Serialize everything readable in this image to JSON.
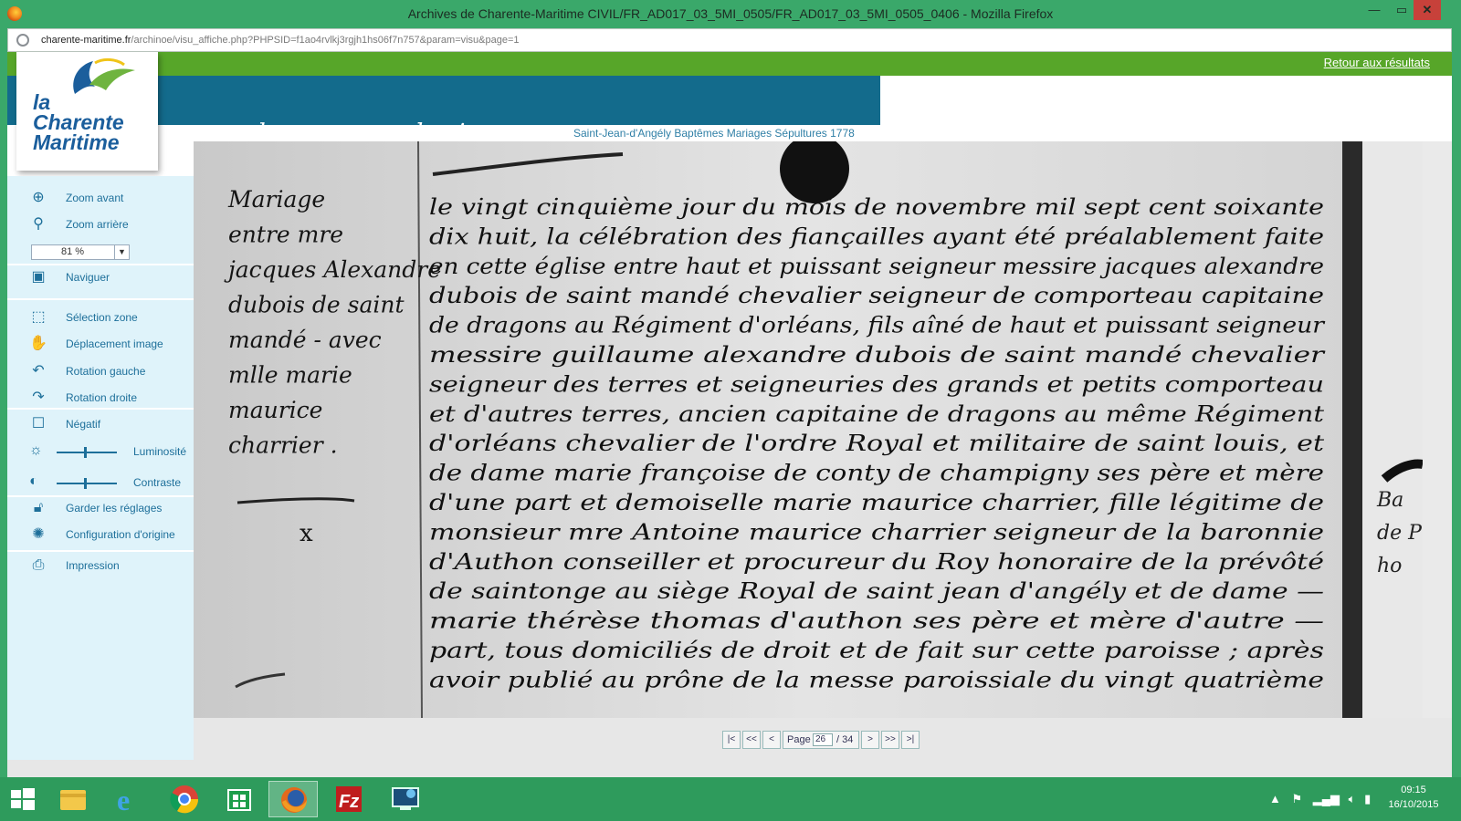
{
  "window": {
    "title": "Archives de Charente-Maritime CIVIL/FR_AD017_03_5MI_0505/FR_AD017_03_5MI_0505_0406 - Mozilla Firefox",
    "minimize": "—",
    "maximize": "▭",
    "close": "✕"
  },
  "address": {
    "domain": "charente-maritime.fr",
    "path": "/archinoe/visu_affiche.php?PHPSID=f1ao4rvlkj3rgjh1hs06f7n757&param=visu&page=1"
  },
  "header": {
    "back_link": "Retour aux résultats",
    "slogan": "ouvre de nouveaux horizons",
    "logo_lines": [
      "la",
      "Charente",
      "Maritime"
    ],
    "doc_title": "Saint-Jean-d'Angély Baptêmes Mariages Sépultures 1778"
  },
  "sidebar": {
    "zoom_in": "Zoom avant",
    "zoom_out": "Zoom arrière",
    "zoom_value": "81 %",
    "navigate": "Naviguer",
    "select_zone": "Sélection zone",
    "move_image": "Déplacement image",
    "rotate_left": "Rotation gauche",
    "rotate_right": "Rotation droite",
    "negative": "Négatif",
    "brightness": "Luminosité",
    "contrast": "Contraste",
    "keep_settings": "Garder les réglages",
    "reset_settings": "Configuration d'origine",
    "print": "Impression"
  },
  "pager": {
    "first": "|<",
    "prev_fast": "<<",
    "prev": "<",
    "page_label": "Page",
    "current_page": "26",
    "total": "/ 34",
    "next": ">",
    "next_fast": ">>",
    "last": ">|"
  },
  "manuscript": {
    "margin_lines": [
      "Mariage",
      "entre mre",
      "jacques Alexandre",
      "dubois de saint",
      "mandé - avec",
      "mlle marie",
      "maurice",
      "charrier ."
    ],
    "margin_mark": "x",
    "body_lines": [
      "le vingt cinquième jour du mois de novembre mil sept cent soixante",
      "dix huit, la célébration des fiançailles ayant été préalablement faite",
      "en cette église entre haut et puissant seigneur messire jacques alexandre",
      "dubois de saint mandé chevalier seigneur de comporteau capitaine",
      "de dragons au Régiment d'orléans, fils aîné de haut et puissant seigneur",
      "messire guillaume alexandre dubois de saint mandé chevalier",
      "seigneur des terres et seigneuries des grands et petits comporteau",
      "et d'autres terres, ancien capitaine de dragons au même Régiment",
      "d'orléans chevalier de l'ordre Royal et militaire de saint louis, et",
      "de dame marie françoise de conty de champigny ses père et mère",
      "d'une part et demoiselle marie maurice charrier, fille légitime de",
      "monsieur mre Antoine maurice charrier seigneur de la baronnie",
      "d'Authon conseiller et procureur du Roy honoraire de la prévôté",
      "de saintonge au siège Royal de saint jean d'angély et de dame —",
      "marie thérèse thomas d'authon ses père et mère d'autre —",
      "part, tous domiciliés de droit et de fait sur cette paroisse ; après",
      "avoir publié au prône de la messe paroissiale du vingt quatrième"
    ],
    "edge_text": [
      "Ba",
      "de P",
      "ho"
    ]
  },
  "taskbar": {
    "apps": [
      "start",
      "file-explorer",
      "internet-explorer",
      "chrome",
      "store",
      "firefox",
      "filezilla",
      "remote-desktop"
    ],
    "clock_time": "09:15",
    "clock_date": "16/10/2015"
  },
  "colors": {
    "titlebar": "#3aa86a",
    "green_band": "#57a629",
    "banner_blue": "#136b8c",
    "sidebar_bg": "#dff3fa",
    "sidebar_text": "#1d6f9a"
  }
}
